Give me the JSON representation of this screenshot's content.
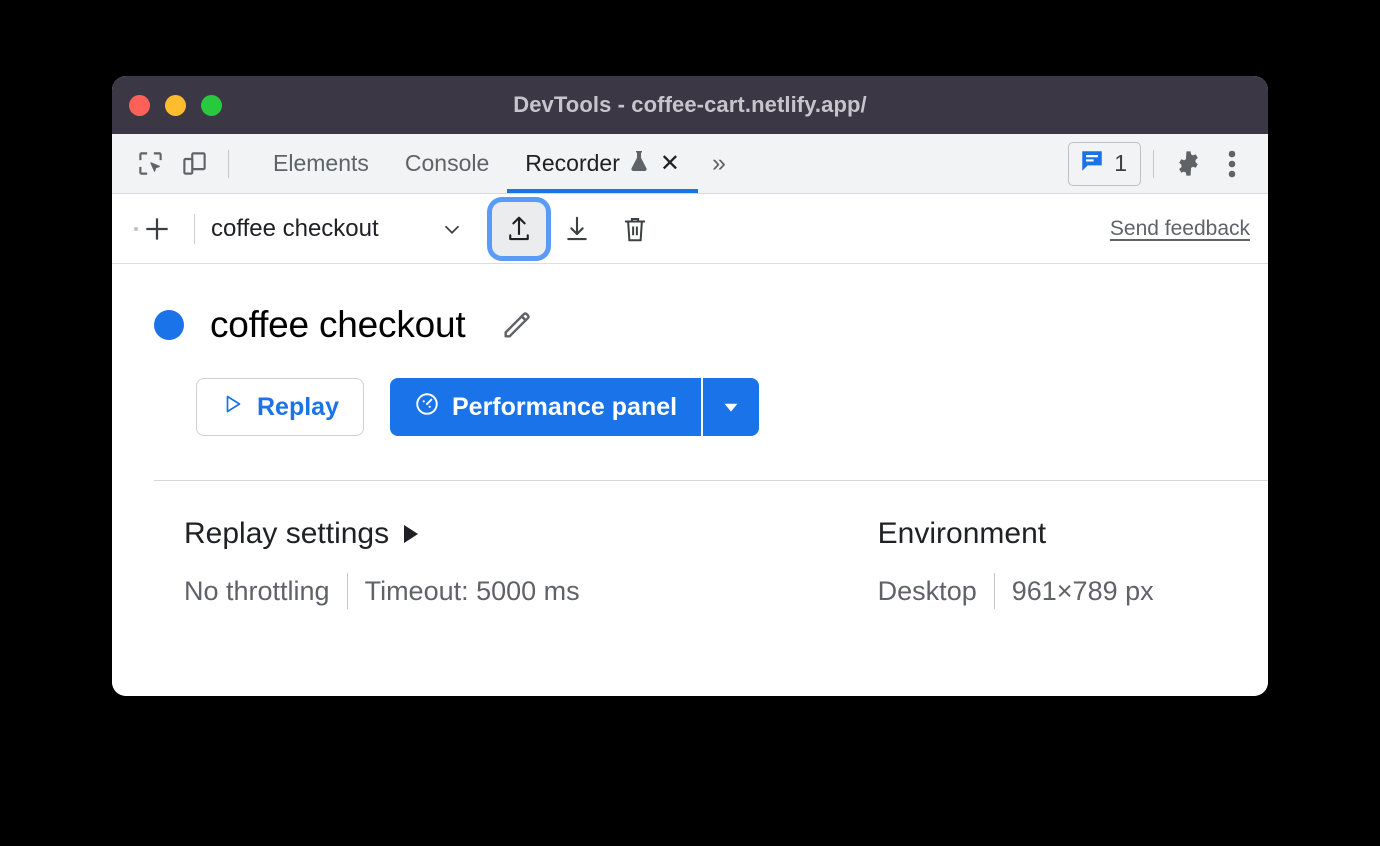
{
  "window": {
    "title": "DevTools - coffee-cart.netlify.app/",
    "traffic_lights": [
      "close-button",
      "minimize-button",
      "maximize-button"
    ]
  },
  "tabbar": {
    "inspect_icon": "inspect-element-icon",
    "device_icon": "device-toolbar-icon",
    "tabs": [
      {
        "label": "Elements",
        "active": false
      },
      {
        "label": "Console",
        "active": false
      },
      {
        "label": "Recorder",
        "active": true,
        "experimental_icon": "flask-icon",
        "close_icon": "close-icon"
      }
    ],
    "more_tabs_label": "»",
    "issues": {
      "icon": "message-bubble-icon",
      "count": "1"
    },
    "settings_icon": "gear-icon",
    "more_options_icon": "three-dots-vertical-icon"
  },
  "recorder_toolbar": {
    "add_recording_icon": "plus-icon",
    "recording_name": "coffee checkout",
    "recording_select_icon": "chevron-down-icon",
    "import_icon": "upload-import-icon",
    "export_icon": "download-export-icon",
    "delete_icon": "trash-delete-icon",
    "send_feedback": "Send feedback",
    "focused_button": "import"
  },
  "recording": {
    "status_dot_color": "#1a73e8",
    "title": "coffee checkout",
    "edit_icon": "pencil-edit-icon",
    "replay_button": {
      "label": "Replay",
      "icon": "play-triangle-icon"
    },
    "performance_button": {
      "label": "Performance panel",
      "icon": "gauge-performance-icon",
      "dropdown_icon": "caret-down-icon"
    }
  },
  "settings": {
    "replay": {
      "heading": "Replay settings",
      "expand_icon": "triangle-right-icon",
      "throttling": "No throttling",
      "timeout": "Timeout: 5000 ms"
    },
    "environment": {
      "heading": "Environment",
      "device": "Desktop",
      "viewport": "961×789 px"
    }
  },
  "colors": {
    "accent": "#1a73e8",
    "titlebar": "#3c3744",
    "tabbar": "#f1f3f4",
    "focus_ring": "#5b9bf8"
  }
}
